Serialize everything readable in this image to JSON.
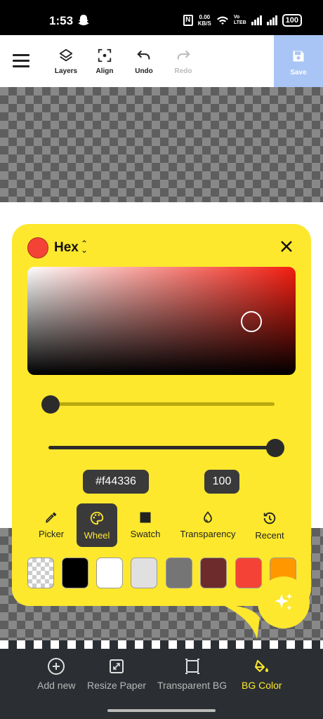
{
  "status_bar": {
    "time": "1:53",
    "net_speed_value": "0.00",
    "net_speed_unit": "KB/S",
    "volte_top": "Vo",
    "volte_bottom": "LTEB",
    "battery": "100"
  },
  "toolbar": {
    "layers_label": "Layers",
    "align_label": "Align",
    "undo_label": "Undo",
    "redo_label": "Redo",
    "save_label": "Save"
  },
  "color_panel": {
    "mode_label": "Hex",
    "selected_color": "#f44336",
    "hex_value": "#f44336",
    "opacity_value": "100",
    "hue_slider_fraction": 0.0,
    "opacity_slider_fraction": 1.0,
    "tabs": [
      {
        "label": "Picker",
        "icon": "eyedropper-icon"
      },
      {
        "label": "Wheel",
        "icon": "palette-icon"
      },
      {
        "label": "Swatch",
        "icon": "square-icon"
      },
      {
        "label": "Transparency",
        "icon": "drop-icon"
      },
      {
        "label": "Recent",
        "icon": "history-icon"
      }
    ],
    "active_tab": "Wheel",
    "swatches": [
      "transparent",
      "#000000",
      "#ffffff",
      "#e0e0e0",
      "#757575",
      "#6d2b2b",
      "#f44336",
      "#ff9800"
    ]
  },
  "bottom_bar": {
    "items": [
      {
        "label": "Add new",
        "icon": "add-circle-icon"
      },
      {
        "label": "Resize Paper",
        "icon": "resize-icon"
      },
      {
        "label": "Transparent BG",
        "icon": "transparent-bg-icon"
      },
      {
        "label": "BG Color",
        "icon": "paint-bucket-icon"
      }
    ],
    "active": "BG Color"
  }
}
